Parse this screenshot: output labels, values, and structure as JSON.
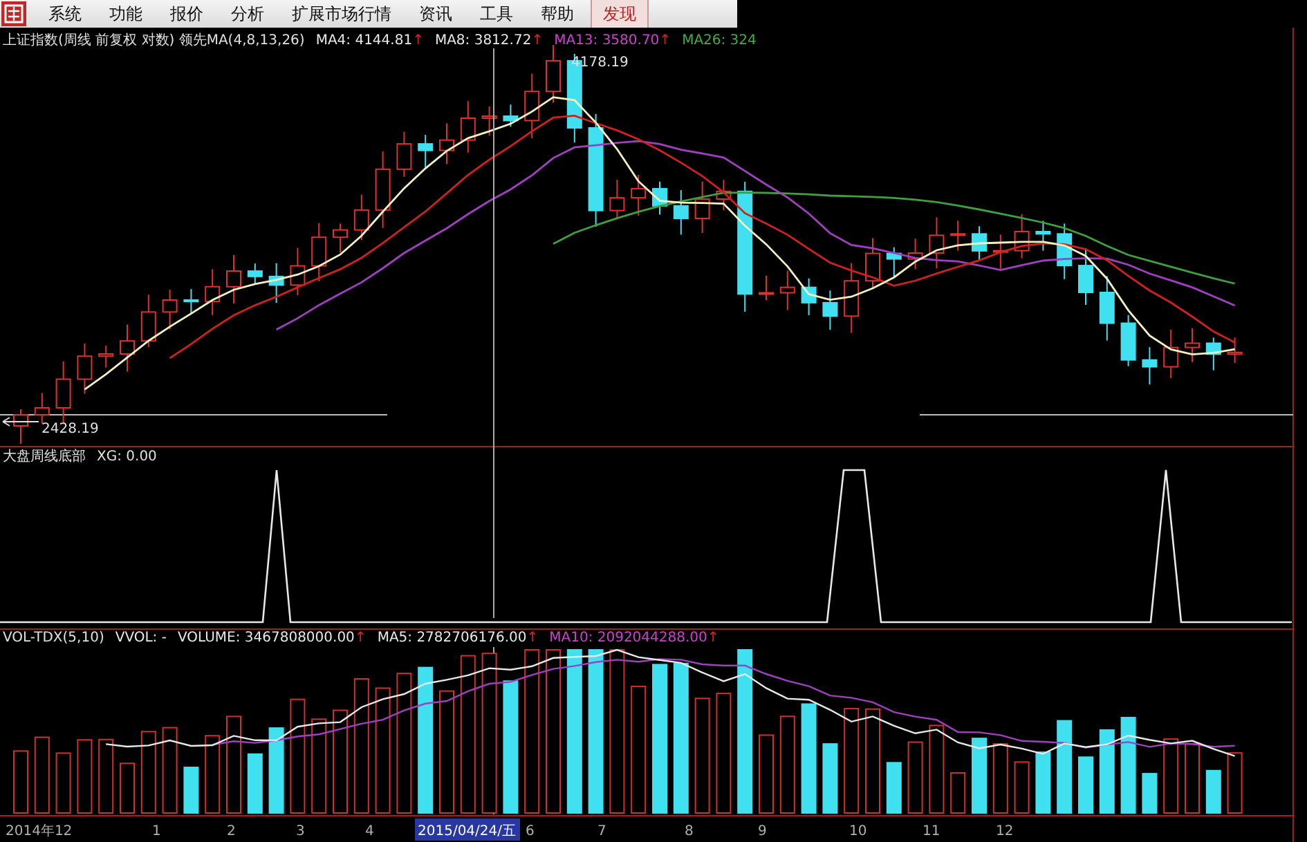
{
  "menu": {
    "items": [
      {
        "label": "系统",
        "selected": false
      },
      {
        "label": "功能",
        "selected": false
      },
      {
        "label": "报价",
        "selected": false
      },
      {
        "label": "分析",
        "selected": false
      },
      {
        "label": "扩展市场行情",
        "selected": false
      },
      {
        "label": "资讯",
        "selected": false
      },
      {
        "label": "工具",
        "selected": false
      },
      {
        "label": "帮助",
        "selected": false
      },
      {
        "label": "发现",
        "selected": true
      }
    ]
  },
  "main_panel": {
    "title": "上证指数(周线 前复权 对数) 领先MA(4,8,13,26)",
    "moving_averages": [
      {
        "label": "MA4: 4144.81",
        "arrow": "↑",
        "color": "#e8e8e8"
      },
      {
        "label": "MA8: 3812.72",
        "arrow": "↑",
        "color": "#e8e8e8"
      },
      {
        "label": "MA13: 3580.70",
        "arrow": "↑",
        "color": "#d040d0"
      },
      {
        "label": "MA26: 324",
        "color": "#40b040"
      }
    ],
    "high_label": "4178.19",
    "low_label": "2428.19"
  },
  "indicator_panel": {
    "name": "大盘周线底部",
    "reading": "XG: 0.00"
  },
  "volume_panel": {
    "title": "VOL-TDX(5,10)",
    "readings": [
      {
        "label": "VVOL: -",
        "color": "#e8e8e8"
      },
      {
        "label": "VOLUME: 3467808000.00",
        "arrow": "↑",
        "color": "#e8e8e8"
      },
      {
        "label": "MA5: 2782706176.00",
        "arrow": "↑",
        "color": "#e8e8e8"
      },
      {
        "label": "MA10: 2092044288.00",
        "arrow": "↑",
        "color": "#d040d0"
      }
    ]
  },
  "x_axis": {
    "labels": [
      {
        "label": "2014年12",
        "selected": false
      },
      {
        "label": "1",
        "selected": false
      },
      {
        "label": "2",
        "selected": false
      },
      {
        "label": "3",
        "selected": false
      },
      {
        "label": "4",
        "selected": false
      },
      {
        "label": "2015/04/24/五",
        "selected": true
      },
      {
        "label": "6",
        "selected": false
      },
      {
        "label": "7",
        "selected": false
      },
      {
        "label": "8",
        "selected": false
      },
      {
        "label": "9",
        "selected": false
      },
      {
        "label": "10",
        "selected": false
      },
      {
        "label": "11",
        "selected": false
      },
      {
        "label": "12",
        "selected": false
      }
    ]
  }
}
